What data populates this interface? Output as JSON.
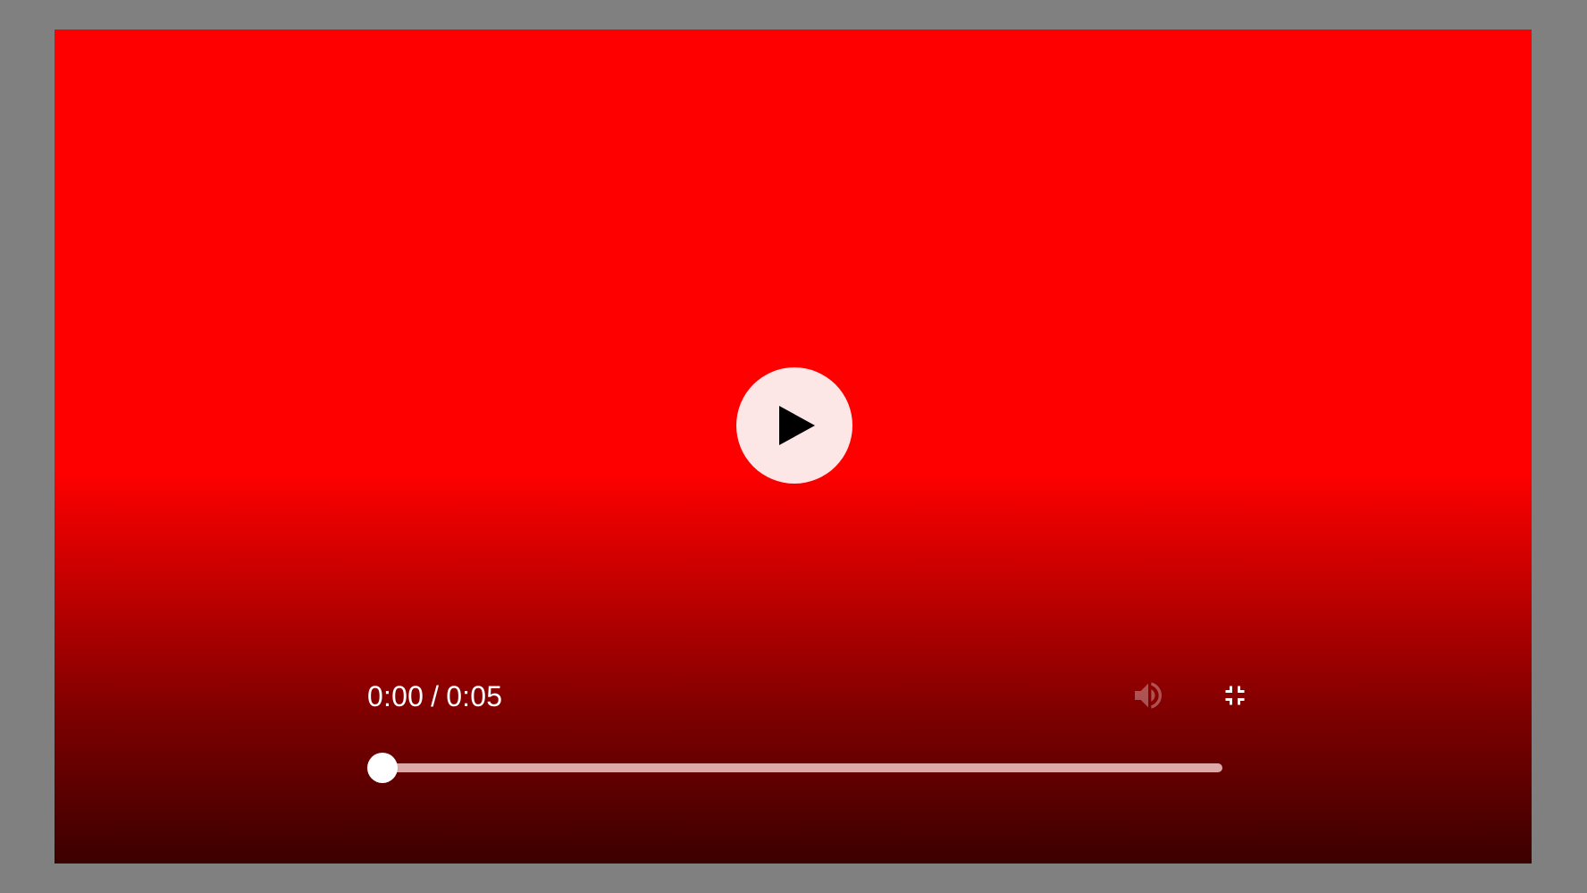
{
  "player": {
    "time": {
      "current": "0:00",
      "separator": "/",
      "duration": "0:05"
    },
    "big_play": {
      "icon": "play-icon"
    },
    "volume": {
      "icon": "volume-icon"
    },
    "fullscreen": {
      "icon": "exit-fullscreen-icon"
    },
    "seek": {
      "progress_fraction": 0.0
    },
    "colors": {
      "page_background": "#808080",
      "video_top": "#ff0000",
      "video_bottom": "#3b0000",
      "play_button_bg": "#fde6e6",
      "controls_fg": "#ffffff"
    }
  }
}
